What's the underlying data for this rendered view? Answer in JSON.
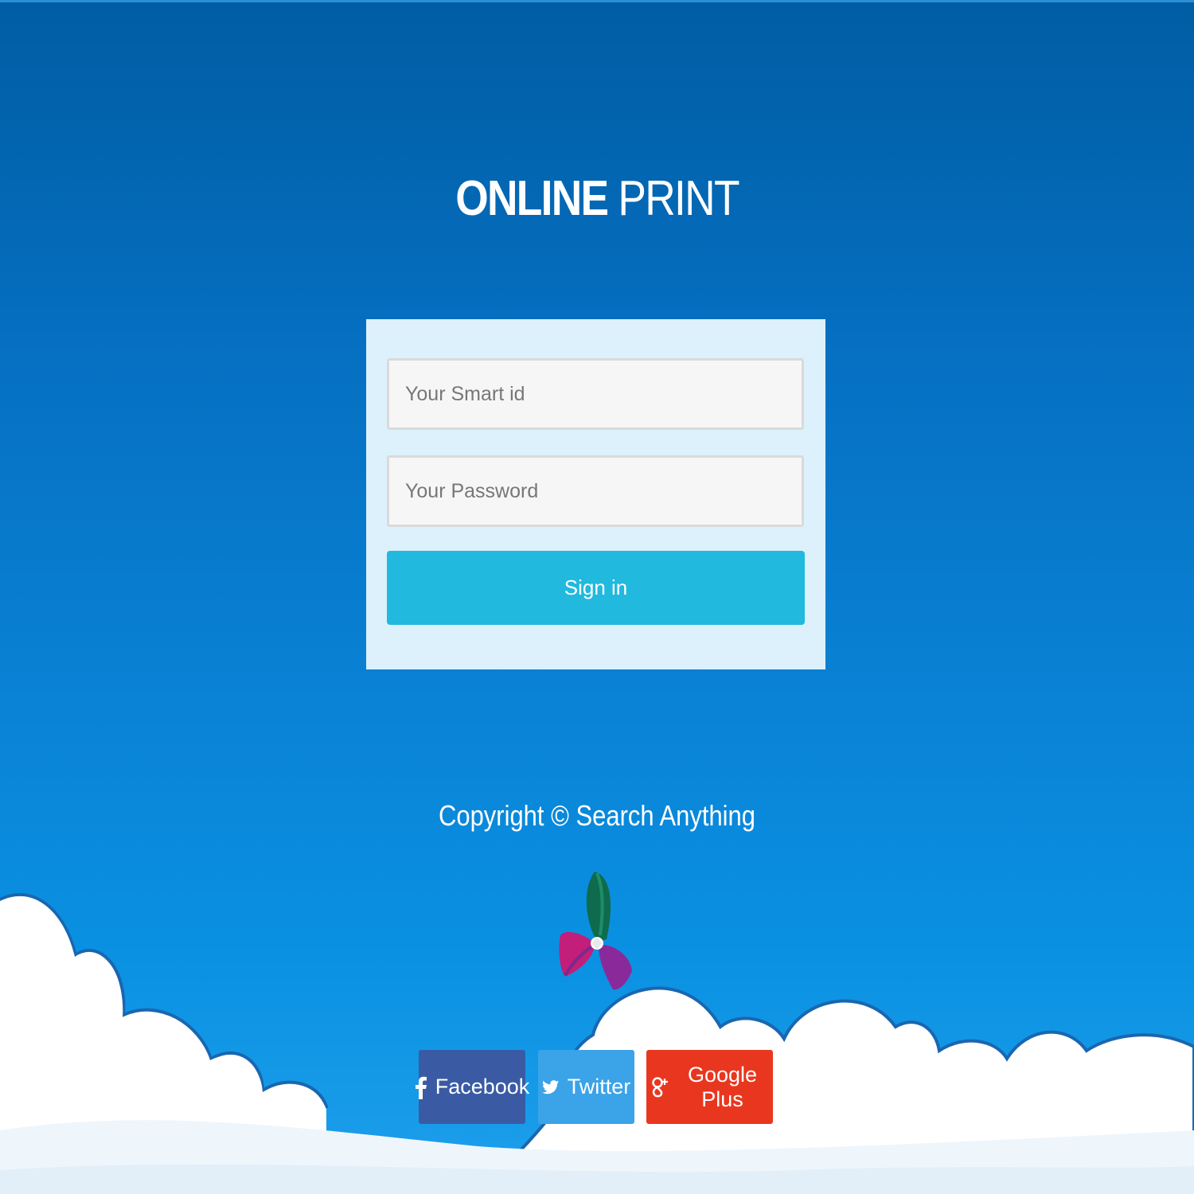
{
  "brand": {
    "title_bold": "ONLINE",
    "title_light": "PRINT"
  },
  "login": {
    "smart_id_placeholder": "Your Smart id",
    "smart_id_value": "",
    "password_placeholder": "Your Password",
    "password_value": "",
    "signin_label": "Sign in"
  },
  "footer": {
    "copyright": "Copyright © Search Anything"
  },
  "social": {
    "facebook_label": "Facebook",
    "twitter_label": "Twitter",
    "googleplus_label": "Google Plus"
  },
  "icons": {
    "facebook": "facebook-icon",
    "twitter": "twitter-icon",
    "googleplus": "google-plus-icon",
    "logo": "pinwheel-logo"
  },
  "colors": {
    "background_top": "#005da3",
    "background_bottom": "#1ea0ec",
    "card": "#dcf1fb",
    "signin": "#21b9de",
    "facebook": "#3a5ba4",
    "twitter": "#3ba3e8",
    "googleplus": "#e9371f"
  }
}
